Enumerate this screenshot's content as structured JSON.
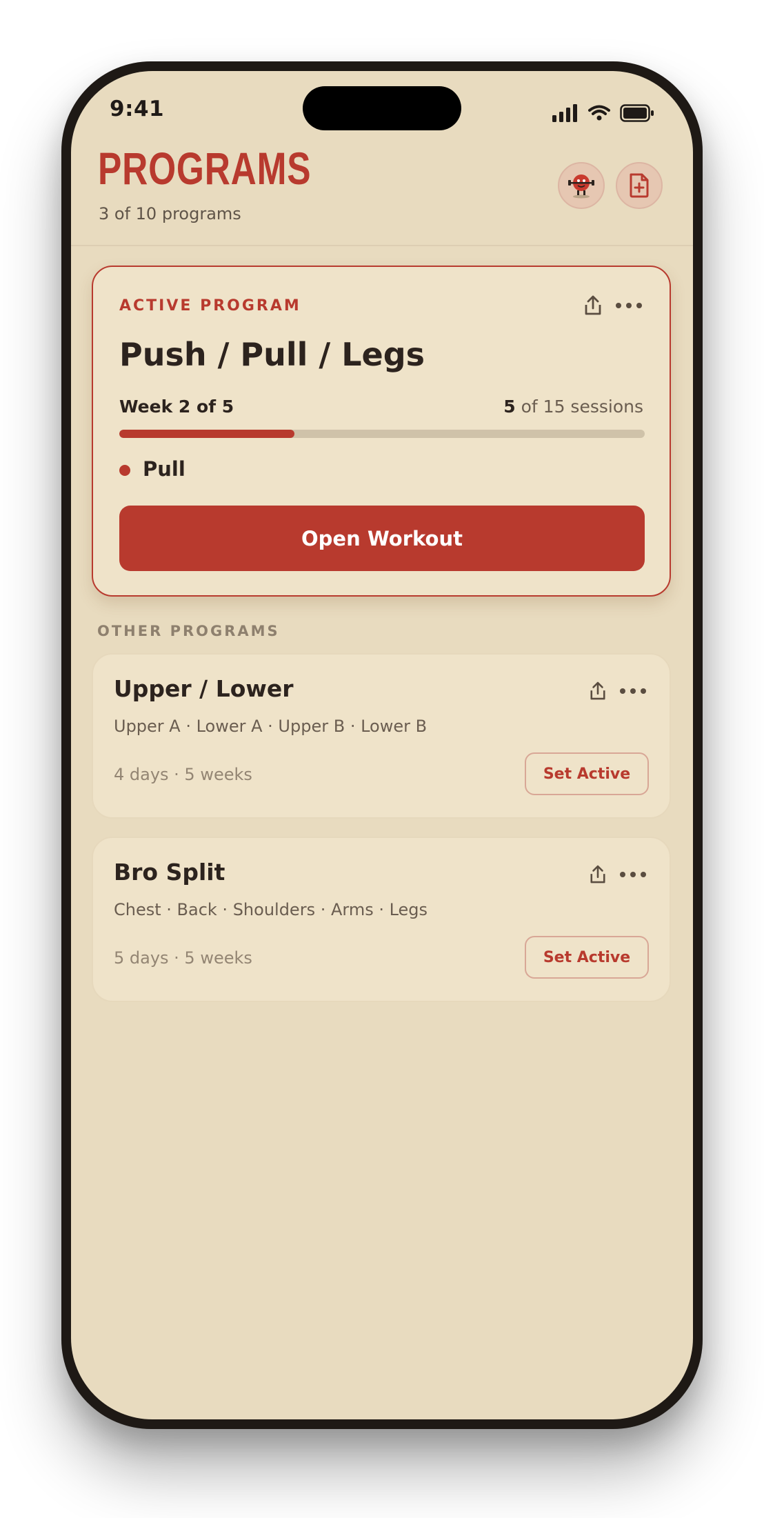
{
  "status": {
    "time": "9:41"
  },
  "header": {
    "title": "PROGRAMS",
    "subtitle": "3 of 10 programs"
  },
  "active_program": {
    "eyebrow": "ACTIVE PROGRAM",
    "name": "Push / Pull / Legs",
    "week_label": "Week 2 of 5",
    "sessions_done": "5",
    "sessions_rest": " of 15 sessions",
    "progress_fraction": 0.333,
    "current_day": "Pull",
    "button_label": "Open Workout"
  },
  "other_section_label": "OTHER PROGRAMS",
  "programs": [
    {
      "name": "Upper / Lower",
      "days": "Upper A · Lower A · Upper B · Lower B",
      "meta": "4 days · 5 weeks",
      "button": "Set Active"
    },
    {
      "name": "Bro Split",
      "days": "Chest · Back · Shoulders · Arms · Legs",
      "meta": "5 days · 5 weeks",
      "button": "Set Active"
    }
  ],
  "icons": {
    "header_buttons": [
      "mascot-icon",
      "add-file-icon"
    ],
    "card_actions": [
      "share-icon",
      "more-icon"
    ]
  },
  "colors": {
    "accent": "#b83a2e",
    "background": "#e8dbbf",
    "card": "#efe3c9",
    "text": "#2c231e"
  }
}
